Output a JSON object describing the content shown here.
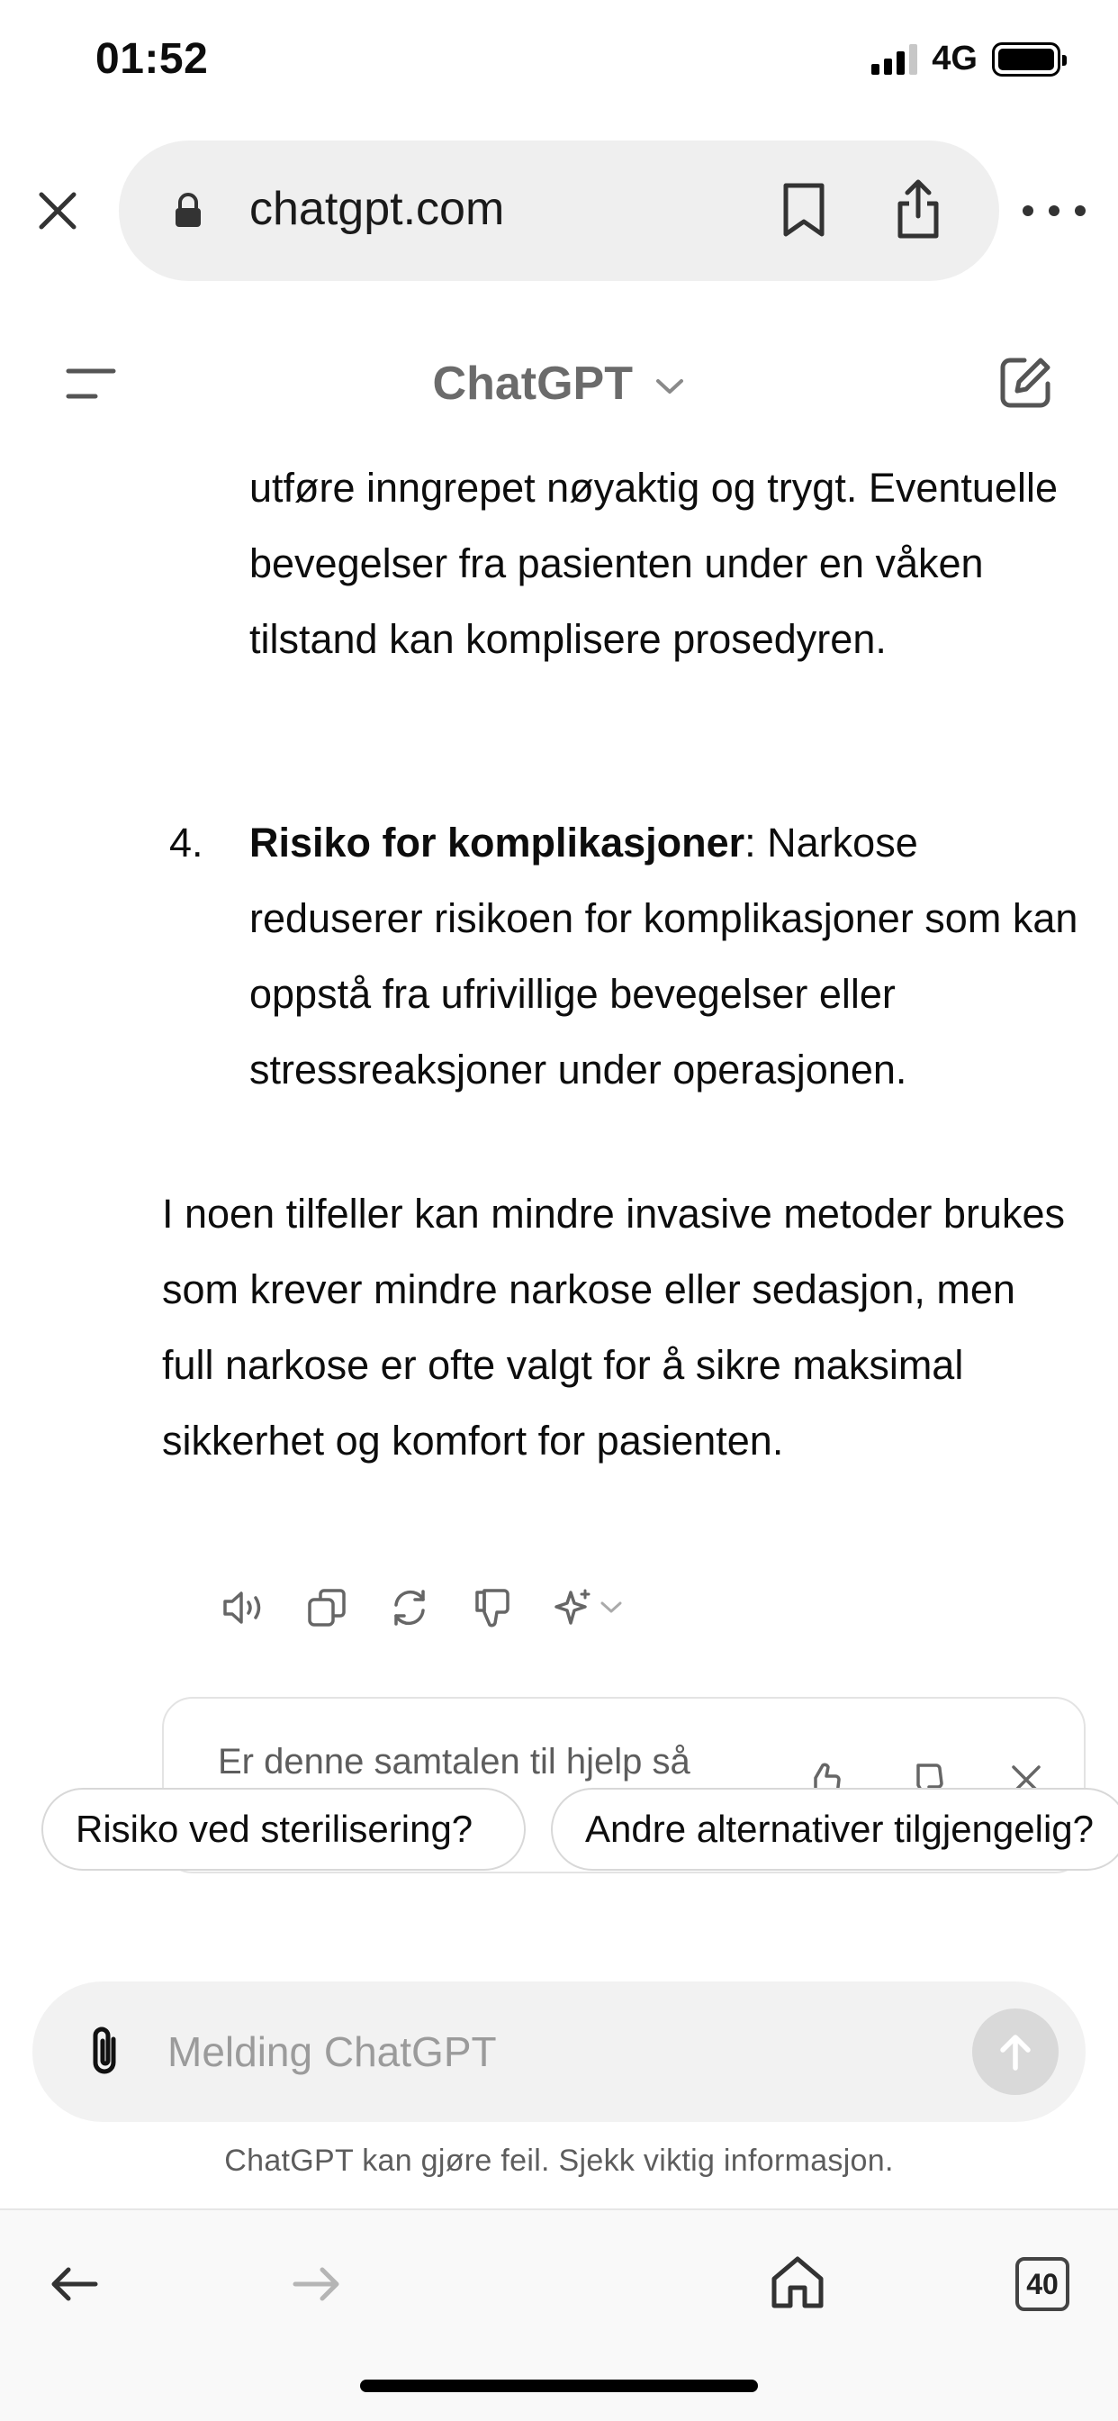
{
  "status_bar": {
    "time": "01:52",
    "network": "4G"
  },
  "browser": {
    "url": "chatgpt.com",
    "icons": [
      "close-icon",
      "lock-icon",
      "bookmark-icon",
      "share-icon",
      "more-icon"
    ]
  },
  "header": {
    "title": "ChatGPT"
  },
  "message": {
    "continuation": "utføre inngrepet nøyaktig og trygt. Eventuelle bevegelser fra pasienten under en våken tilstand kan komplisere prosedyren.",
    "item4_number": "4.",
    "item4_title": "Risiko for komplikasjoner",
    "item4_body": ": Narkose reduserer risikoen for komplikasjoner som kan oppstå fra ufrivillige bevegelser eller stressreaksjoner under operasjonen.",
    "outro": "I noen tilfeller kan mindre invasive metoder brukes som krever mindre narkose eller sedasjon, men full narkose er ofte valgt for å sikre maksimal sikkerhet og komfort for pasienten."
  },
  "message_actions": [
    "read-aloud-icon",
    "copy-icon",
    "regenerate-icon",
    "thumbs-down-icon",
    "sparkle-icon"
  ],
  "feedback": {
    "text": "Er denne samtalen til hjelp så"
  },
  "suggestions": [
    "Risiko ved sterilisering?",
    "Andre alternativer tilgjengelig?"
  ],
  "composer": {
    "placeholder": "Melding ChatGPT"
  },
  "disclaimer": "ChatGPT kan gjøre feil. Sjekk viktig informasjon.",
  "bottom_nav": {
    "tab_count": "40"
  }
}
